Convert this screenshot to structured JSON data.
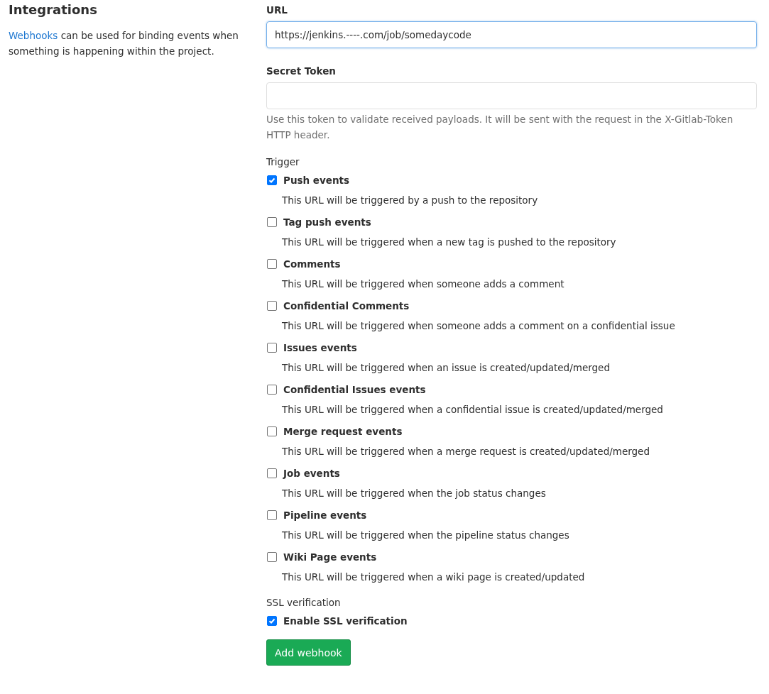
{
  "section": {
    "title": "Integrations",
    "link": "Webhooks",
    "description": " can be used for binding events when something is happening within the project."
  },
  "url_field": {
    "label": "URL",
    "value": "https://jenkins.----.com/job/somedaycode",
    "focused": true
  },
  "token_field": {
    "label": "Secret Token",
    "help": "Use this token to validate received payloads. It will be sent with the request in the X-Gitlab-Token HTTP header."
  },
  "trigger": {
    "label": "Trigger",
    "items": [
      {
        "label": "Push events",
        "description": "This URL will be triggered by a push to the repository",
        "checked": true
      },
      {
        "label": "Tag push events",
        "description": "This URL will be triggered when a new tag is pushed to the repository",
        "checked": false
      },
      {
        "label": "Comments",
        "description": "This URL will be triggered when someone adds a comment",
        "checked": false
      },
      {
        "label": "Confidential Comments",
        "description": "This URL will be triggered when someone adds a comment on a confidential issue",
        "checked": false
      },
      {
        "label": "Issues events",
        "description": "This URL will be triggered when an issue is created/updated/merged",
        "checked": false
      },
      {
        "label": "Confidential Issues events",
        "description": "This URL will be triggered when a confidential issue is created/updated/merged",
        "checked": false
      },
      {
        "label": "Merge request events",
        "description": "This URL will be triggered when a merge request is created/updated/merged",
        "checked": false
      },
      {
        "label": "Job events",
        "description": "This URL will be triggered when the job status changes",
        "checked": false
      },
      {
        "label": "Pipeline events",
        "description": "This URL will be triggered when the pipeline status changes",
        "checked": false
      },
      {
        "label": "Wiki Page events",
        "description": "This URL will be triggered when a wiki page is created/updated",
        "checked": false
      }
    ]
  },
  "ssl": {
    "label": "SSL verification",
    "option": {
      "label": "Enable SSL verification",
      "checked": true
    }
  },
  "submit": {
    "label": "Add webhook"
  }
}
